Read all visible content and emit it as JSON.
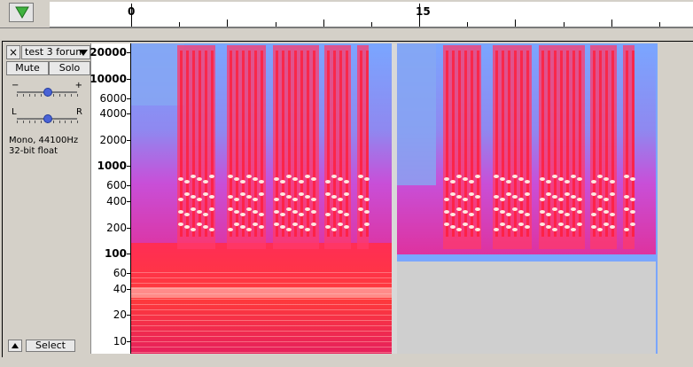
{
  "timeline": {
    "ruler_labels": [
      {
        "text": "0",
        "time": 0
      },
      {
        "text": "15",
        "time": 15
      }
    ]
  },
  "track": {
    "close_label": "×",
    "name": "test 3 forum",
    "mute_label": "Mute",
    "solo_label": "Solo",
    "gain_minus": "−",
    "gain_plus": "+",
    "pan_left": "L",
    "pan_right": "R",
    "gain_position": 0.5,
    "pan_position": 0.5,
    "info_rate": "Mono, 44100Hz",
    "info_format": "32-bit float",
    "select_label": "Select"
  },
  "freq_ruler": {
    "labels": [
      "20000",
      "10000",
      "6000",
      "4000",
      "2000",
      "1000",
      "600",
      "400",
      "200",
      "100",
      "60",
      "40",
      "20",
      "10"
    ]
  },
  "colors": {
    "spectrogram_hot": "#ff2d55",
    "spectrogram_cool": "#7aa6ff",
    "play_triangle": "#3fb23f",
    "knob": "#4a63d6"
  }
}
